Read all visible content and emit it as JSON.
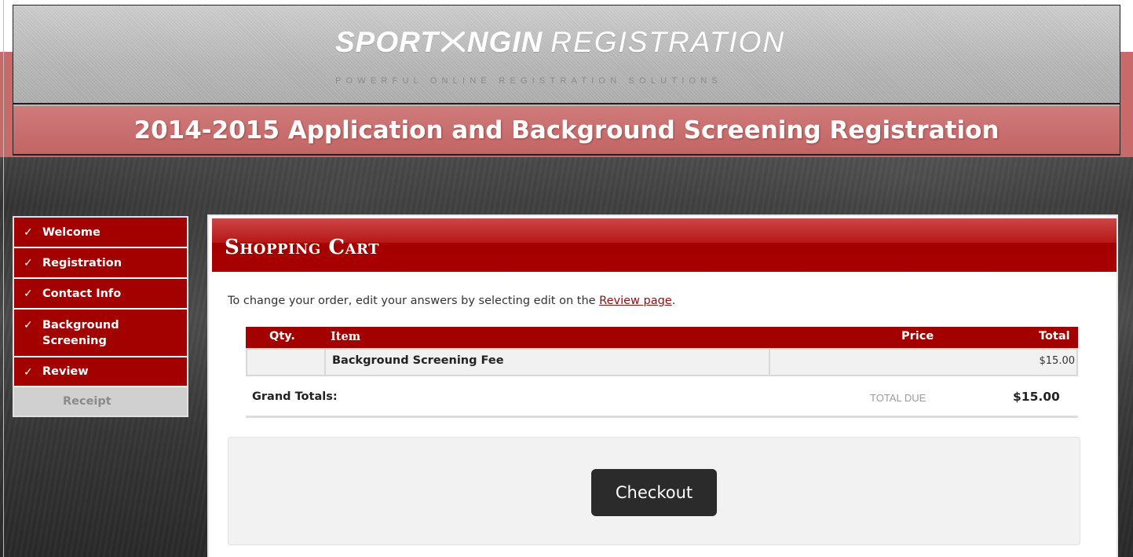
{
  "header": {
    "brand": "SPORT",
    "brand_icon": "ngin-x-logo-icon",
    "brand_suffix": "NGIN",
    "product": "REGISTRATION",
    "tagline": "POWERFUL ONLINE REGISTRATION SOLUTIONS",
    "page_title": "2014-2015 Application and Background Screening Registration"
  },
  "sidebar": {
    "check_glyph": "✓",
    "items": [
      {
        "label": "Welcome",
        "completed": true
      },
      {
        "label": "Registration",
        "completed": true
      },
      {
        "label": "Contact Info",
        "completed": true
      },
      {
        "label_line1": "Background",
        "label_line2": "Screening",
        "completed": true
      },
      {
        "label": "Review",
        "completed": true
      },
      {
        "label": "Receipt",
        "completed": false
      }
    ]
  },
  "cart": {
    "title": "Shopping Cart",
    "intro_prefix": "To change your order, edit your answers by selecting edit on the ",
    "intro_link": "Review page",
    "intro_suffix": ".",
    "columns": {
      "qty": "Qty.",
      "item": "Item",
      "price": "Price",
      "total": "Total"
    },
    "rows": [
      {
        "qty": "",
        "item": "Background Screening Fee",
        "price": "",
        "total": "$15.00"
      }
    ],
    "grand_totals_label": "Grand Totals:",
    "total_due_label": "TOTAL DUE",
    "total_due_amount": "$15.00",
    "checkout_label": "Checkout"
  },
  "colors": {
    "accent_red": "#a30000",
    "header_pink": "#c96a6a",
    "button_dark": "#2b2b2b"
  }
}
